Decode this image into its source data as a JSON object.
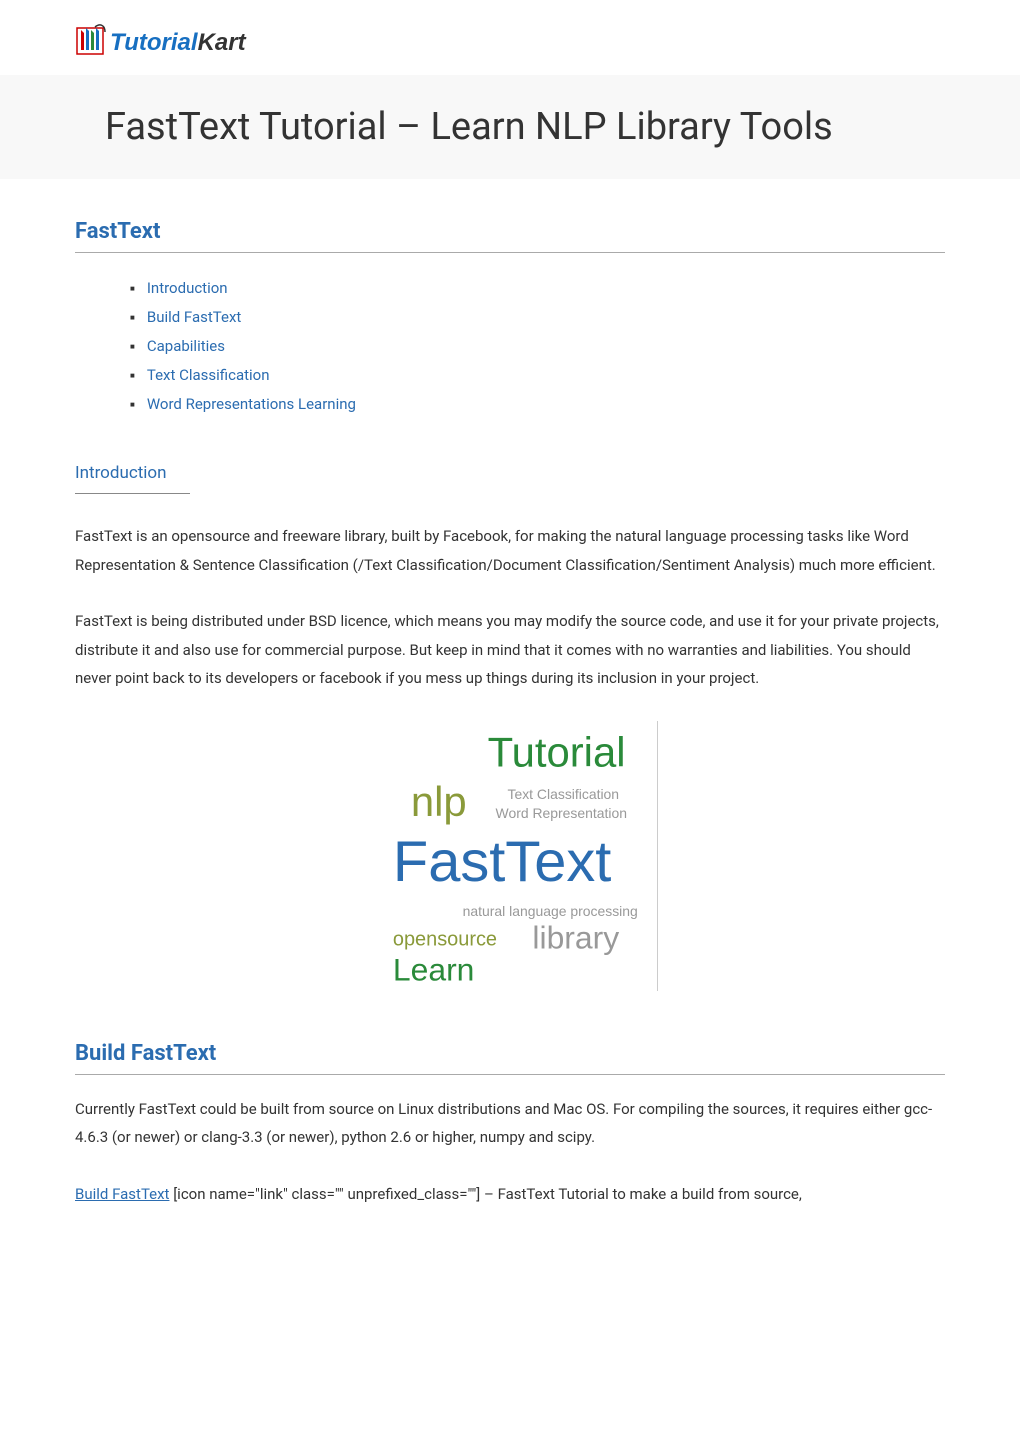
{
  "header": {
    "logo_text_1": "Tutorial",
    "logo_text_2": "Kart"
  },
  "page_title": "FastText Tutorial – Learn NLP Library Tools",
  "sections": {
    "fasttext": {
      "heading": "FastText",
      "toc": [
        {
          "label": "Introduction"
        },
        {
          "label": "Build FastText"
        },
        {
          "label": "Capabilities"
        },
        {
          "label": "Text Classification"
        },
        {
          "label": "Word Representations Learning"
        }
      ]
    },
    "introduction": {
      "heading": "Introduction",
      "paragraph1": "FastText is an opensource and freeware library, built by Facebook, for making the natural language processing tasks like Word Representation & Sentence Classification (/Text Classification/Document Classification/Sentiment Analysis) much more efficient.",
      "paragraph2": "FastText is being distributed under BSD licence, which means you may modify the source code, and use it for your private projects, distribute it and also use for commercial purpose. But keep in mind that it comes with no warranties and liabilities. You should never point back to its developers or facebook if you mess up things during its inclusion in your project."
    },
    "wordcloud": {
      "words": {
        "tutorial": "Tutorial",
        "nlp": "nlp",
        "text_classification": "Text Classification",
        "word_representation": "Word Representation",
        "fasttext": "FastText",
        "natural_language_processing": "natural language processing",
        "opensource": "opensource",
        "library": "library",
        "learn": "Learn"
      }
    },
    "build_fasttext": {
      "heading": "Build FastText",
      "paragraph1": "Currently FastText could be built from source on Linux distributions and Mac OS. For compiling the sources, it requires either gcc-4.6.3 (or newer) or clang-3.3 (or newer), python 2.6 or higher, numpy and scipy.",
      "link_text": "Build FastText",
      "paragraph2_rest": " [icon name=\"link\" class=\"\" unprefixed_class=\"\"]  – FastText Tutorial to make a build from source,"
    }
  }
}
